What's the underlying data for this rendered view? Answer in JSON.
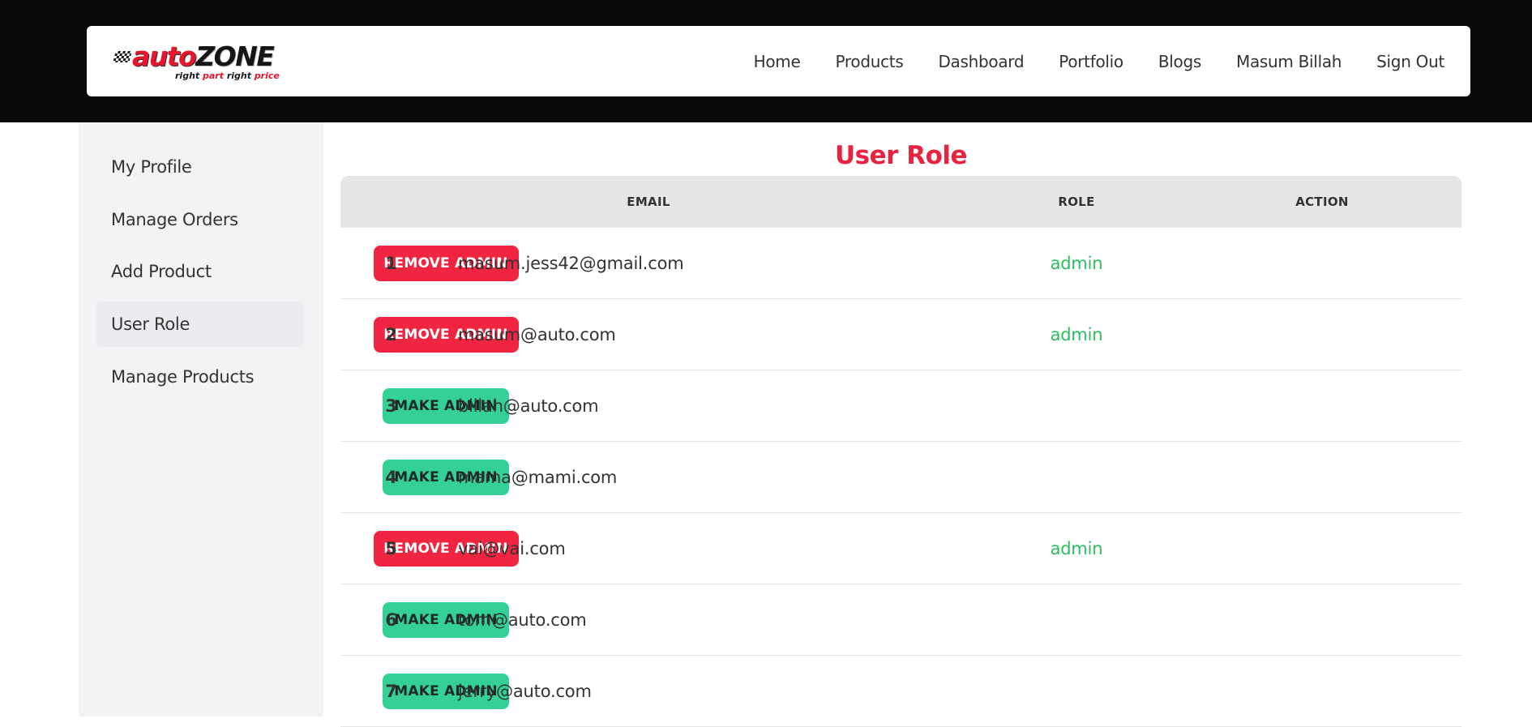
{
  "header": {
    "logo": {
      "word1": "auto",
      "word2": "ZONE",
      "tagline_parts": [
        "right ",
        "part",
        " right ",
        "price"
      ]
    },
    "nav": [
      "Home",
      "Products",
      "Dashboard",
      "Portfolio",
      "Blogs",
      "Masum Billah",
      "Sign Out"
    ]
  },
  "sidebar": {
    "items": [
      "My Profile",
      "Manage Orders",
      "Add Product",
      "User Role",
      "Manage Products"
    ],
    "active_item": "User Role"
  },
  "main": {
    "title": "User Role",
    "columns": [
      "",
      "EMAIL",
      "ROLE",
      "ACTION"
    ],
    "rows": [
      {
        "num": "1",
        "email": "masum.jess42@gmail.com",
        "role": "admin",
        "action": "REMOVE ADMIN"
      },
      {
        "num": "2",
        "email": "masum@auto.com",
        "role": "admin",
        "action": "REMOVE ADMIN"
      },
      {
        "num": "3",
        "email": "billah@auto.com",
        "role": "",
        "action": "MAKE ADMIN"
      },
      {
        "num": "4",
        "email": "mama@mami.com",
        "role": "",
        "action": "MAKE ADMIN"
      },
      {
        "num": "5",
        "email": "vai@vai.com",
        "role": "admin",
        "action": "REMOVE ADMIN"
      },
      {
        "num": "6",
        "email": "tom@auto.com",
        "role": "",
        "action": "MAKE ADMIN"
      },
      {
        "num": "7",
        "email": "jerry@auto.com",
        "role": "",
        "action": "MAKE ADMIN"
      }
    ]
  },
  "colors": {
    "brand_red": "#e8233f",
    "admin_green": "#2bbd5e",
    "remove_button": "#ef2541",
    "make_button": "#35d096",
    "topbar": "#090909",
    "sidebar_bg": "#f2f3f5"
  }
}
